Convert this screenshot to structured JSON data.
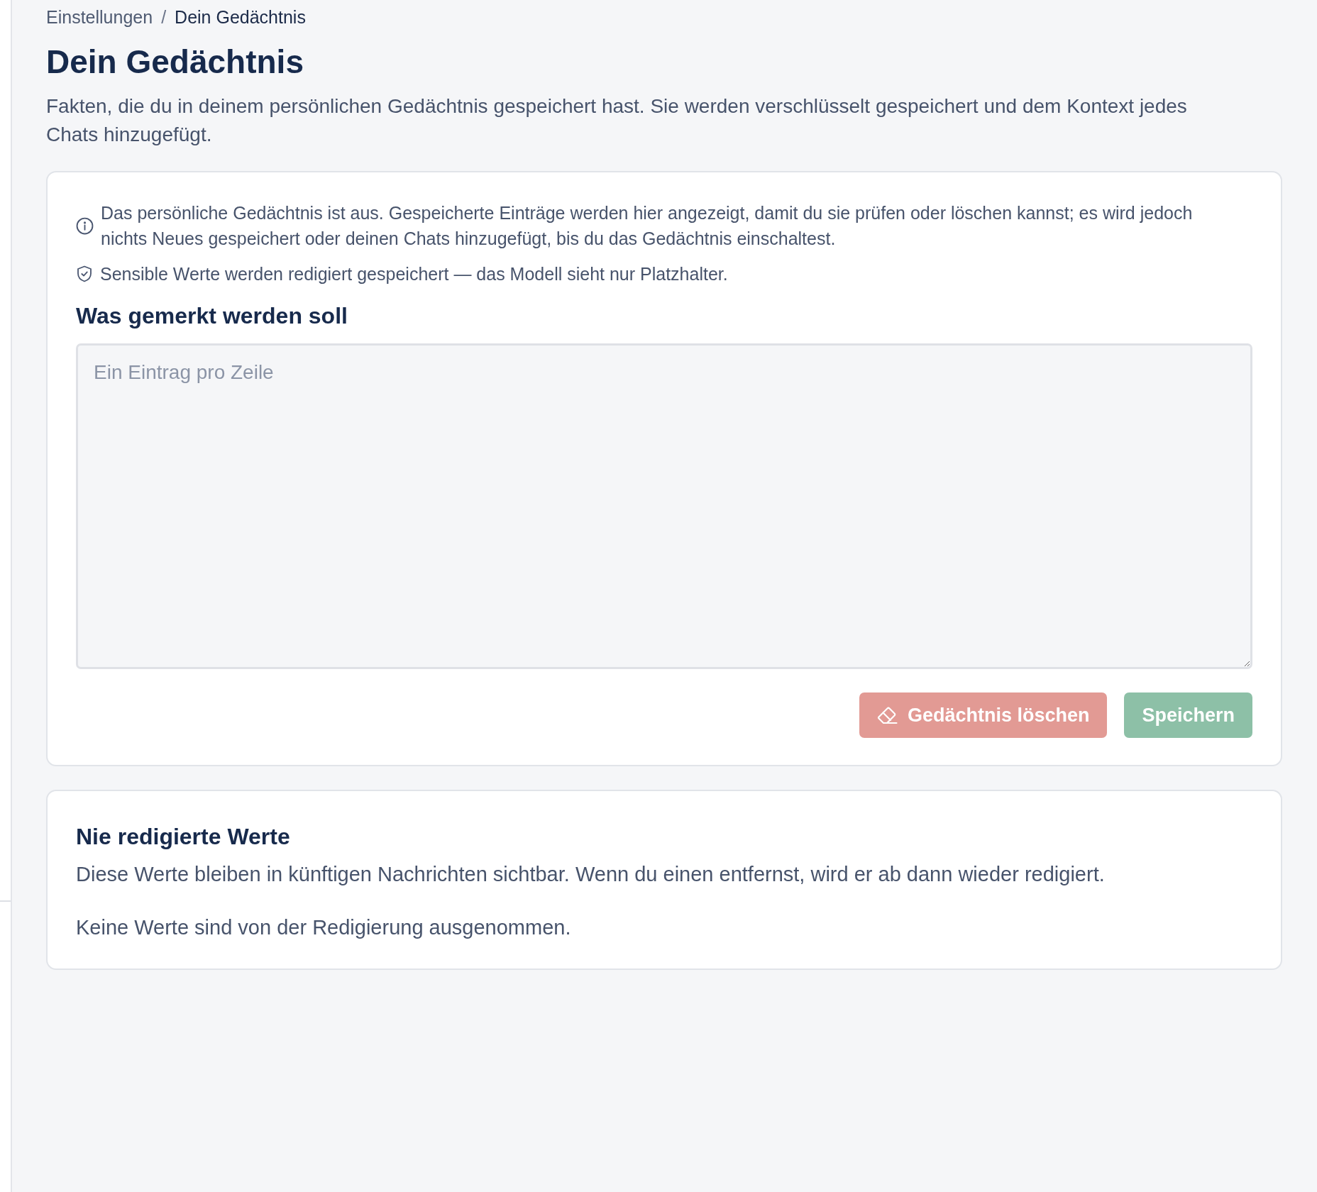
{
  "breadcrumb": {
    "separator": "/",
    "items": [
      {
        "label": "Einstellungen",
        "current": false
      },
      {
        "label": "Dein Gedächtnis",
        "current": true
      }
    ]
  },
  "page": {
    "title": "Dein Gedächtnis",
    "description": "Fakten, die du in deinem persönlichen Gedächtnis gespeichert hast. Sie werden verschlüsselt gespeichert und dem Kontext jedes Chats hinzugefügt."
  },
  "memory_card": {
    "notices": [
      {
        "kind": "info",
        "text": "Das persönliche Gedächtnis ist aus. Gespeicherte Einträge werden hier angezeigt, damit du sie prüfen oder löschen kannst; es wird jedoch nichts Neues gespeichert oder deinen Chats hinzugefügt, bis du das Gedächtnis einschaltest."
      },
      {
        "kind": "privacy",
        "text": "Sensible Werte werden redigiert gespeichert — das Modell sieht nur Platzhalter."
      }
    ],
    "heading": "Was gemerkt werden soll",
    "entries_field": {
      "placeholder": "Ein Eintrag pro Zeile"
    },
    "buttons": [
      {
        "kind": "danger",
        "label": "Gedächtnis löschen",
        "disabled": true
      },
      {
        "kind": "primary",
        "label": "Speichern",
        "disabled": true
      }
    ]
  },
  "exceptions_card": {
    "heading": "Nie redigierte Werte",
    "description": "Diese Werte bleiben in künftigen Nachrichten sichtbar. Wenn du einen entfernst, wird er ab dann wieder redigiert.",
    "empty_text": "Keine Werte sind von der Redigierung ausgenommen."
  }
}
